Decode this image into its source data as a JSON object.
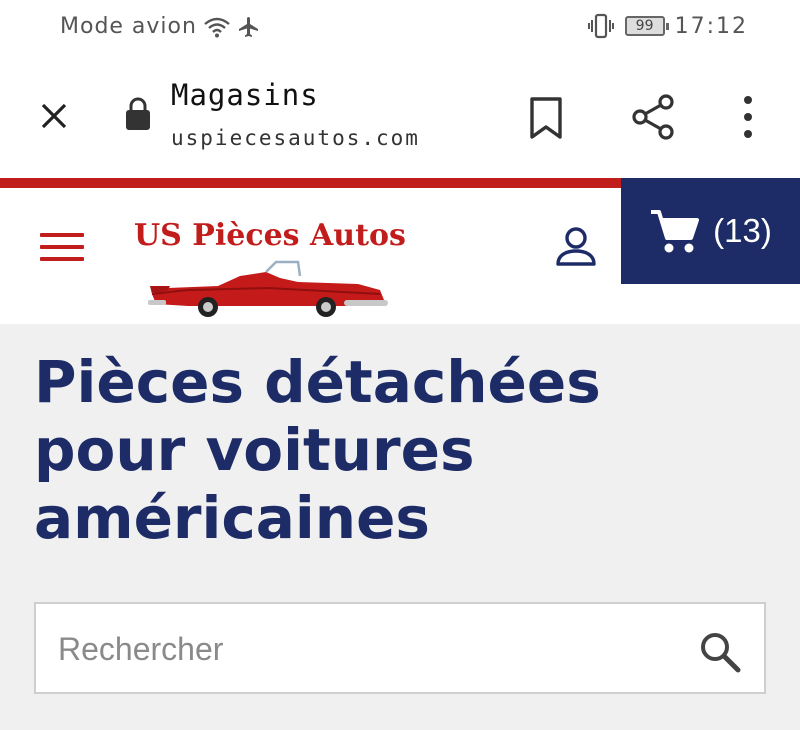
{
  "status_bar": {
    "mode_text": "Mode avion",
    "battery_level": "99",
    "time": "17:12",
    "icons": [
      "wifi-icon",
      "airplane-icon",
      "vibrate-icon",
      "battery-icon"
    ]
  },
  "browser": {
    "title": "Magasins",
    "url": "uspiecesautos.com",
    "icons": [
      "close-icon",
      "lock-icon",
      "bookmark-icon",
      "share-icon",
      "more-vert-icon"
    ]
  },
  "header": {
    "logo_text": "US Pièces Autos",
    "cart_count": "(13)",
    "icons": [
      "menu-icon",
      "account-icon",
      "cart-icon"
    ]
  },
  "hero": {
    "title_line1": "Pièces détachées",
    "title_line2": "pour voitures",
    "title_line3": "américaines"
  },
  "search": {
    "placeholder": "Rechercher",
    "value": "",
    "icon": "search-icon"
  },
  "colors": {
    "brand_red": "#c21d1d",
    "brand_navy": "#1d2c66",
    "hero_bg": "#f0f0f0"
  }
}
